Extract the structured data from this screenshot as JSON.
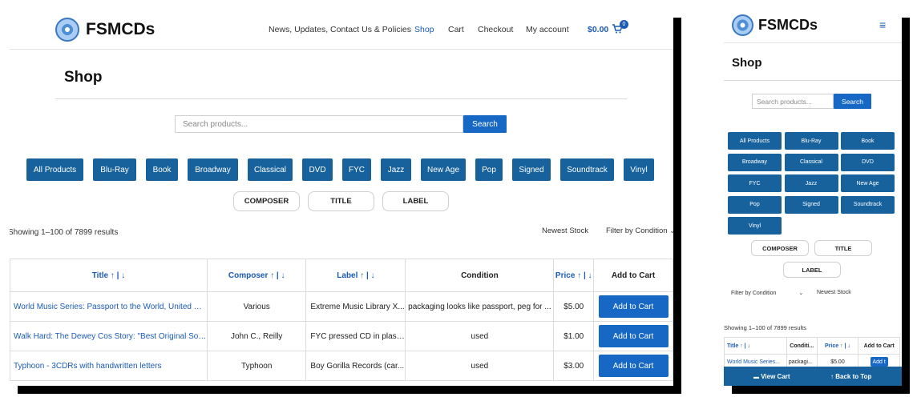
{
  "brand": {
    "name": "FSMCDs"
  },
  "nav": [
    "News, Updates, Contact Us & Policies",
    "Shop",
    "Cart",
    "Checkout",
    "My account"
  ],
  "cart": {
    "total": "$0.00",
    "count": "0"
  },
  "page_title": "Shop",
  "search": {
    "placeholder": "Search products...",
    "button": "Search"
  },
  "categories": [
    "All Products",
    "Blu-Ray",
    "Book",
    "Broadway",
    "Classical",
    "DVD",
    "FYC",
    "Jazz",
    "New Age",
    "Pop",
    "Signed",
    "Soundtrack",
    "Vinyl"
  ],
  "sort_buttons": [
    "COMPOSER",
    "TITLE",
    "LABEL"
  ],
  "results_text": "Showing 1–100 of 7899 results",
  "order_select": "Newest Stock",
  "condition_select": "Filter by Condition",
  "table": {
    "headers": {
      "title": "Title ↑ | ↓",
      "composer": "Composer ↑ | ↓",
      "label": "Label ↑ | ↓",
      "condition": "Condition",
      "price": "Price ↑ | ↓",
      "add": "Add to Cart"
    },
    "rows": [
      {
        "title": "World Music Series: Passport to the World, United Re...",
        "composer": "Various",
        "label": "Extreme Music Library X...",
        "condition": "packaging looks like passport, peg for ...",
        "price": "$5.00",
        "button": "Add to Cart"
      },
      {
        "title": "Walk Hard: The Dewey Cos Story: \"Best Original Son...",
        "composer": "John C., Reilly",
        "label": "FYC pressed CD in plasti...",
        "condition": "used",
        "price": "$1.00",
        "button": "Add to Cart"
      },
      {
        "title": "Typhoon - 3CDRs with handwritten letters",
        "composer": "Typhoon",
        "label": "Boy Gorilla Records (car...",
        "condition": "used",
        "price": "$3.00",
        "button": "Add to Cart"
      }
    ]
  },
  "mobile": {
    "menu_icon": "≡",
    "headers": {
      "title": "Title ↑ | ↓",
      "condition": "Conditi...",
      "price": "Price ↑ | ↓",
      "add": "Add to Cart"
    },
    "row": {
      "title": "World Music Series...",
      "condition": "packagi...",
      "price": "$5.00",
      "button": "Add t"
    },
    "view_cart": "View Cart",
    "back_to_top": "↑ Back to Top"
  }
}
